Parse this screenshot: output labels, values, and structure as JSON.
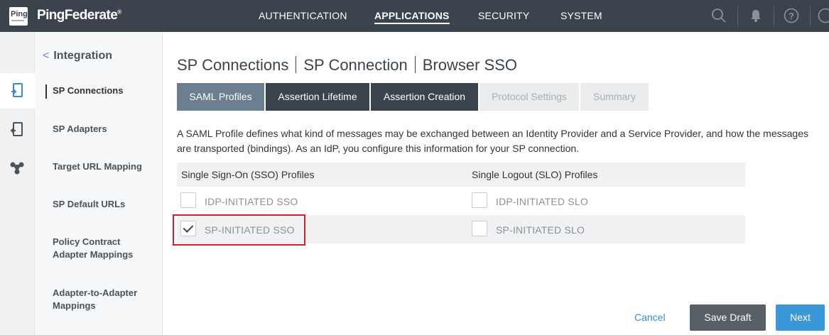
{
  "header": {
    "logo_text": "Ping",
    "brand": "PingFederate",
    "nav": [
      "AUTHENTICATION",
      "APPLICATIONS",
      "SECURITY",
      "SYSTEM"
    ],
    "active_nav": "APPLICATIONS"
  },
  "subnav": {
    "title": "Integration",
    "items": [
      "SP Connections",
      "SP Adapters",
      "Target URL Mapping",
      "SP Default URLs",
      "Policy Contract Adapter Mappings",
      "Adapter-to-Adapter Mappings"
    ]
  },
  "breadcrumb": [
    "SP Connections",
    "SP Connection",
    "Browser SSO"
  ],
  "tabs": [
    "SAML Profiles",
    "Assertion Lifetime",
    "Assertion Creation",
    "Protocol Settings",
    "Summary"
  ],
  "description": "A SAML Profile defines what kind of messages may be exchanged between an Identity Provider and a Service Provider, and how the messages are transported (bindings). As an IdP, you configure this information for your SP connection.",
  "profiles": {
    "sso_header": "Single Sign-On (SSO) Profiles",
    "slo_header": "Single Logout (SLO) Profiles",
    "rows": [
      {
        "sso": "IDP-INITIATED SSO",
        "sso_checked": false,
        "slo": "IDP-INITIATED SLO",
        "slo_checked": false
      },
      {
        "sso": "SP-INITIATED SSO",
        "sso_checked": true,
        "slo": "SP-INITIATED SLO",
        "slo_checked": false
      }
    ]
  },
  "footer": {
    "cancel": "Cancel",
    "save_draft": "Save Draft",
    "next": "Next"
  },
  "colors": {
    "topbar": "#3b444c",
    "accent_blue": "#3a97d8",
    "highlight_red": "#d0202a"
  }
}
